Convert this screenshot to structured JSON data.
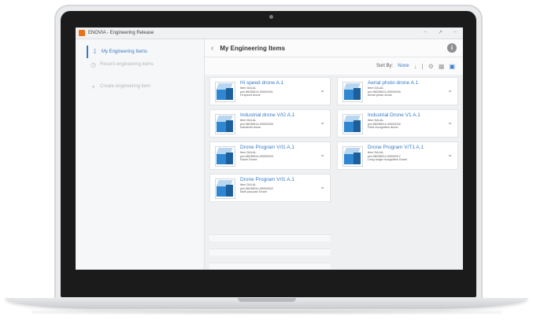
{
  "window": {
    "title": "ENOVIA - Engineering Release"
  },
  "sidebar": {
    "items": [
      {
        "label": "My Engineering Items",
        "icon": "share-icon"
      },
      {
        "label": "Recent engineering items",
        "icon": "clock-icon"
      },
      {
        "label": "Create engineering item",
        "icon": "plus-icon"
      }
    ]
  },
  "main": {
    "title": "My Engineering Items",
    "sort_label": "Sort By:",
    "sort_value": "None"
  },
  "cards": [
    {
      "title": "Hi speed drone A.1",
      "owner": "Item DALAL",
      "id": "prd-98236514-00000041",
      "desc": "Hi speed drone"
    },
    {
      "title": "Aerial photo drone A.1",
      "owner": "Item DALAL",
      "id": "prd-98236514-00000040",
      "desc": "Aerial photo drone"
    },
    {
      "title": "Industrial drone V/I2 A.1",
      "owner": "Item DALAL",
      "id": "prd-98236514-00000039",
      "desc": "Industrial drone"
    },
    {
      "title": "Industrial Drone V1 A.1",
      "owner": "Item DALAL",
      "id": "prd-98236514-00000032",
      "desc": "Field recognition drone"
    },
    {
      "title": "Drone Program V/I1 A.1",
      "owner": "Item DALAL",
      "id": "prd-98236514-00000029",
      "desc": "Racer Drone"
    },
    {
      "title": "Drone Program V/T1 A.1",
      "owner": "Item DALAL",
      "id": "prd-98236514-00000017",
      "desc": "Long range recognition Drone"
    },
    {
      "title": "Drone Program V/I1 A.1",
      "owner": "Item DALAL",
      "id": "prd-98236514-00000002",
      "desc": "Multi purpose Drone"
    }
  ]
}
